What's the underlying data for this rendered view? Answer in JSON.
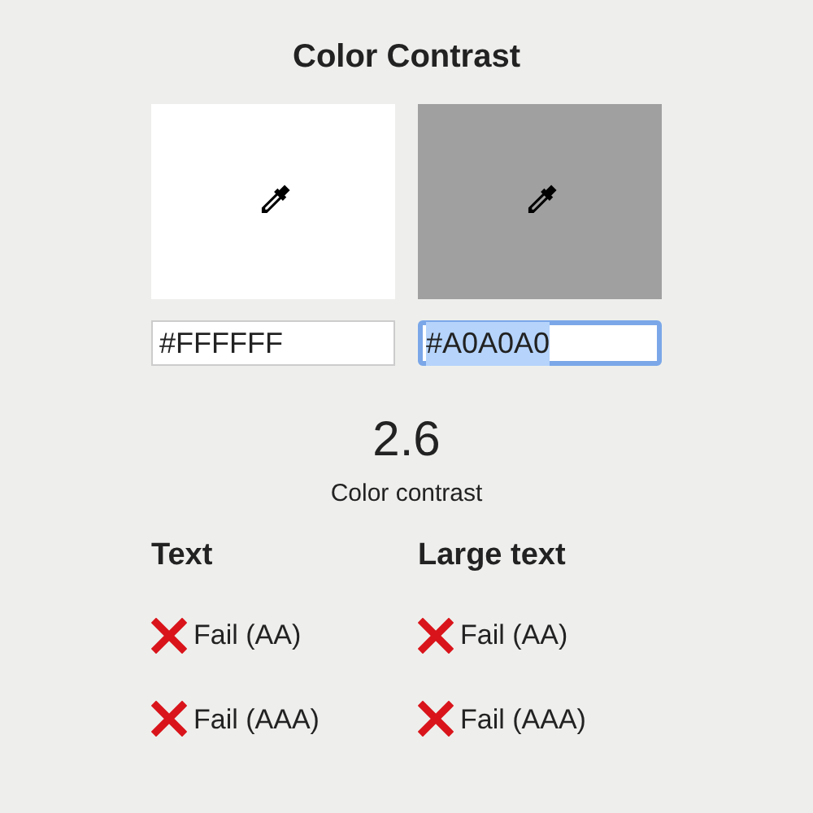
{
  "title": "Color Contrast",
  "swatches": [
    {
      "color": "#ffffff",
      "value": "#FFFFFF",
      "focused": false
    },
    {
      "color": "#a0a0a0",
      "value": "#A0A0A0",
      "focused": true
    }
  ],
  "ratio": "2.6",
  "ratio_label": "Color contrast",
  "groups": [
    {
      "heading": "Text",
      "results": [
        {
          "label": "Fail (AA)",
          "passed": false
        },
        {
          "label": "Fail (AAA)",
          "passed": false
        }
      ]
    },
    {
      "heading": "Large text",
      "results": [
        {
          "label": "Fail (AA)",
          "passed": false
        },
        {
          "label": "Fail (AAA)",
          "passed": false
        }
      ]
    }
  ]
}
